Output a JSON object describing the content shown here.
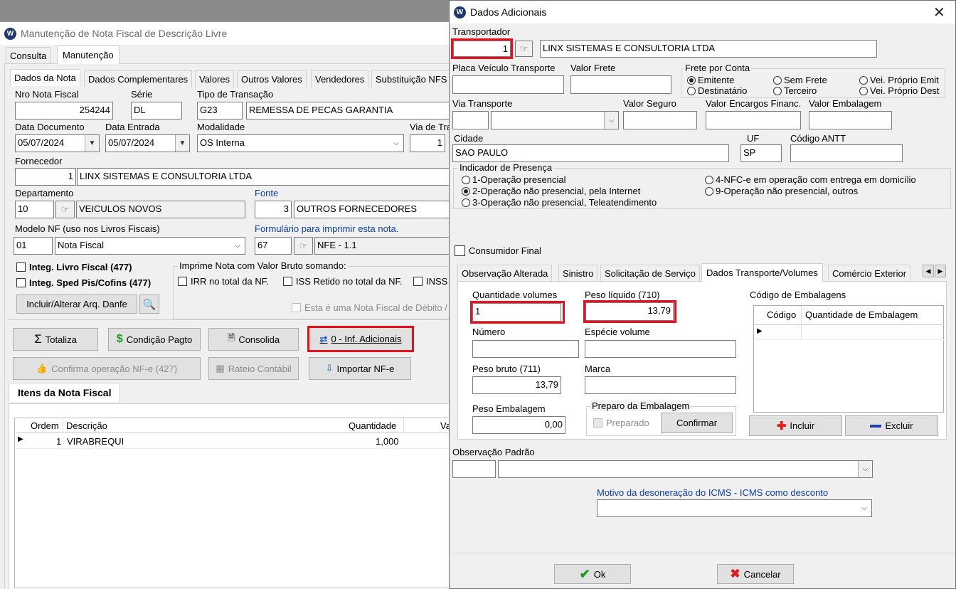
{
  "main": {
    "title": "Manutenção de Nota Fiscal de Descrição Livre",
    "top_tabs": [
      "Consulta",
      "Manutenção"
    ],
    "sub_tabs": [
      "Dados da Nota",
      "Dados Complementares",
      "Valores",
      "Outros Valores",
      "Vendedores",
      "Substituição NFS"
    ],
    "labels": {
      "nro": "Nro Nota Fiscal",
      "serie": "Série",
      "tipo": "Tipo de Transação",
      "data_doc": "Data Documento",
      "data_ent": "Data Entrada",
      "modalidade": "Modalidade",
      "via": "Via de Tra",
      "fornecedor": "Fornecedor",
      "departamento": "Departamento",
      "fonte": "Fonte",
      "modelo": "Modelo NF (uso nos Livros Fiscais)",
      "formulario": "Formulário para imprimir esta nota.",
      "imprime": "Imprime Nota com Valor Bruto somando:"
    },
    "values": {
      "nro": "254244",
      "serie": "DL",
      "tipo_cod": "G23",
      "tipo_desc": "REMESSA DE PECAS GARANTIA",
      "data_doc": "05/07/2024",
      "data_ent": "05/07/2024",
      "modalidade": "OS Interna",
      "via": "1",
      "forn_cod": "1",
      "forn_nome": "LINX SISTEMAS E CONSULTORIA LTDA",
      "dep_cod": "10",
      "dep_nome": "VEICULOS NOVOS",
      "fonte_cod": "3",
      "fonte_nome": "OUTROS FORNECEDORES",
      "modelo_cod": "01",
      "modelo_nome": "Nota Fiscal",
      "form_cod": "67",
      "form_nome": "NFE - 1.1"
    },
    "checks": {
      "livro": "Integ. Livro Fiscal (477)",
      "sped": "Integ. Sped Pis/Cofins (477)",
      "irr": "IRR no total da NF.",
      "iss": "ISS Retido no total da NF.",
      "inss": "INSS",
      "debito": "Esta é uma Nota Fiscal de Débito /"
    },
    "buttons": {
      "danfe": "Incluir/Alterar Arq. Danfe",
      "totaliza": "Totaliza",
      "cond": "Condição Pagto",
      "consolida": "Consolida",
      "inf": "0 - Inf. Adicionais",
      "confirma": "Confirma operação NF-e (427)",
      "rateio": "Rateio Contábil",
      "importar": "Importar NF-e"
    },
    "itens_title": "Itens da Nota Fiscal",
    "grid_headers": [
      "Ordem",
      "Descrição",
      "Quantidade",
      "Va"
    ],
    "grid_rows": [
      {
        "ordem": "1",
        "descricao": "VIRABREQUI",
        "quantidade": "1,000"
      }
    ]
  },
  "dialog": {
    "title": "Dados Adicionais",
    "labels": {
      "transportador": "Transportador",
      "placa": "Placa Veículo Transporte",
      "frete": "Valor Frete",
      "frete_conta": "Frete por Conta",
      "via": "Via Transporte",
      "seguro": "Valor Seguro",
      "encargos": "Valor Encargos Financ.",
      "embalagem": "Valor Embalagem",
      "cidade": "Cidade",
      "uf": "UF",
      "antt": "Código ANTT",
      "presenca": "Indicador de Presença",
      "obs_padrao": "Observação Padrão",
      "motivo": "Motivo da desoneração do ICMS - ICMS como desconto"
    },
    "values": {
      "transp_cod": "1",
      "transp_nome": "LINX SISTEMAS E CONSULTORIA LTDA",
      "cidade": "SAO PAULO",
      "uf": "SP"
    },
    "frete_opts": [
      "Emitente",
      "Sem Frete",
      "Vei. Próprio Emit",
      "Destinatário",
      "Terceiro",
      "Vei. Próprio Dest"
    ],
    "frete_selected": "Emitente",
    "presenca_opts": [
      "1-Operação presencial",
      "2-Operação não presencial, pela Internet",
      "3-Operação não presencial, Teleatendimento",
      "4-NFC-e em operação com entrega em domicílio",
      "9-Operação não presencial, outros"
    ],
    "presenca_selected": "2-Operação não presencial, pela Internet",
    "consumidor": "Consumidor Final",
    "tabs": [
      "Observação Alterada",
      "Sinistro",
      "Solicitação de Serviço",
      "Dados Transporte/Volumes",
      "Comércio Exterior"
    ],
    "active_tab": "Dados Transporte/Volumes",
    "vol": {
      "qtd_label": "Quantidade volumes",
      "qtd": "1",
      "peso_liq_label": "Peso líquido (710)",
      "peso_liq": "13,79",
      "numero_label": "Número",
      "especie_label": "Espécie volume",
      "peso_bruto_label": "Peso bruto (711)",
      "peso_bruto": "13,79",
      "marca_label": "Marca",
      "peso_emb_label": "Peso Embalagem",
      "peso_emb": "0,00",
      "preparo_label": "Preparo da Embalagem",
      "preparado": "Preparado",
      "confirmar": "Confirmar",
      "cod_emb_label": "Código de Embalagens",
      "cod_col": "Código",
      "qtd_emb_col": "Quantidade de Embalagem",
      "incluir": "Incluir",
      "excluir": "Excluir"
    },
    "ok": "Ok",
    "cancelar": "Cancelar"
  }
}
